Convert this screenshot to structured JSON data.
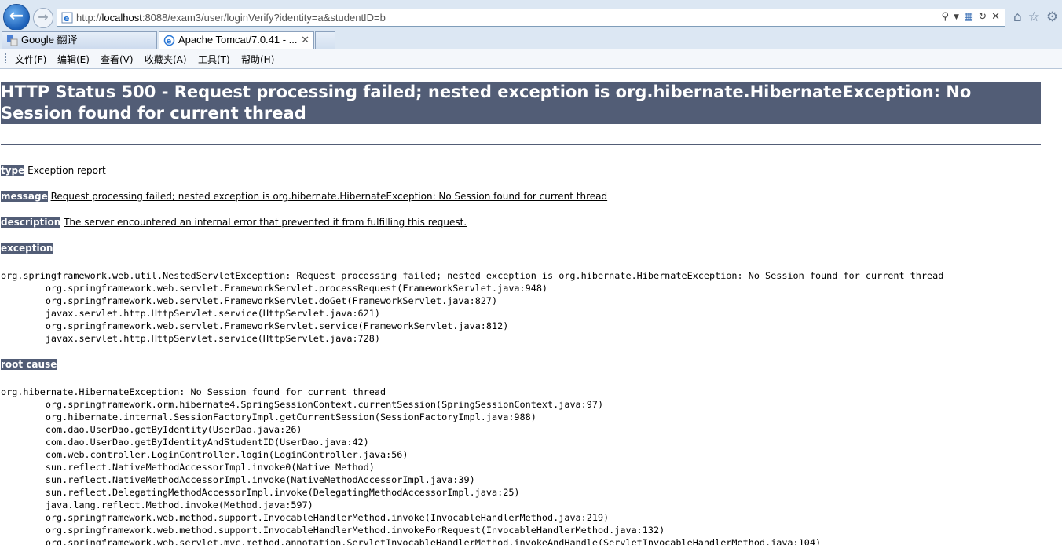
{
  "browser": {
    "url_prefix": "http://",
    "url_host": "localhost",
    "url_rest": ":8088/exam3/user/loginVerify?identity=a&studentID=b",
    "tabs": [
      {
        "label": "Google 翻译"
      },
      {
        "label": "Apache Tomcat/7.0.41 - ..."
      }
    ],
    "menu": [
      "文件(F)",
      "编辑(E)",
      "查看(V)",
      "收藏夹(A)",
      "工具(T)",
      "帮助(H)"
    ]
  },
  "page": {
    "title": "HTTP Status 500 - Request processing failed; nested exception is org.hibernate.HibernateException: No Session found for current thread",
    "type_label": "type",
    "type_value": "Exception report",
    "message_label": "message",
    "message_value": "Request processing failed; nested exception is org.hibernate.HibernateException: No Session found for current thread",
    "description_label": "description",
    "description_value": "The server encountered an internal error that prevented it from fulfilling this request.",
    "exception_label": "exception",
    "exception_trace": "org.springframework.web.util.NestedServletException: Request processing failed; nested exception is org.hibernate.HibernateException: No Session found for current thread\n\torg.springframework.web.servlet.FrameworkServlet.processRequest(FrameworkServlet.java:948)\n\torg.springframework.web.servlet.FrameworkServlet.doGet(FrameworkServlet.java:827)\n\tjavax.servlet.http.HttpServlet.service(HttpServlet.java:621)\n\torg.springframework.web.servlet.FrameworkServlet.service(FrameworkServlet.java:812)\n\tjavax.servlet.http.HttpServlet.service(HttpServlet.java:728)",
    "root_cause_label": "root cause",
    "root_cause_trace": "org.hibernate.HibernateException: No Session found for current thread\n\torg.springframework.orm.hibernate4.SpringSessionContext.currentSession(SpringSessionContext.java:97)\n\torg.hibernate.internal.SessionFactoryImpl.getCurrentSession(SessionFactoryImpl.java:988)\n\tcom.dao.UserDao.getByIdentity(UserDao.java:26)\n\tcom.dao.UserDao.getByIdentityAndStudentID(UserDao.java:42)\n\tcom.web.controller.LoginController.login(LoginController.java:56)\n\tsun.reflect.NativeMethodAccessorImpl.invoke0(Native Method)\n\tsun.reflect.NativeMethodAccessorImpl.invoke(NativeMethodAccessorImpl.java:39)\n\tsun.reflect.DelegatingMethodAccessorImpl.invoke(DelegatingMethodAccessorImpl.java:25)\n\tjava.lang.reflect.Method.invoke(Method.java:597)\n\torg.springframework.web.method.support.InvocableHandlerMethod.invoke(InvocableHandlerMethod.java:219)\n\torg.springframework.web.method.support.InvocableHandlerMethod.invokeForRequest(InvocableHandlerMethod.java:132)\n\torg.springframework.web.servlet.mvc.method.annotation.ServletInvocableHandlerMethod.invokeAndHandle(ServletInvocableHandlerMethod.java:104)"
  },
  "colors": {
    "tomcat_header": "#525d76",
    "chrome_bg": "#dce7f3"
  },
  "icons": {
    "back": "back-arrow-icon",
    "forward": "forward-arrow-icon",
    "page": "ie-page-icon",
    "search": "search-icon",
    "compat": "compatibility-view-icon",
    "refresh": "refresh-icon",
    "stop": "stop-icon",
    "home": "home-icon",
    "favorites": "star-icon",
    "tools": "gear-icon",
    "tab_close": "close-icon"
  }
}
